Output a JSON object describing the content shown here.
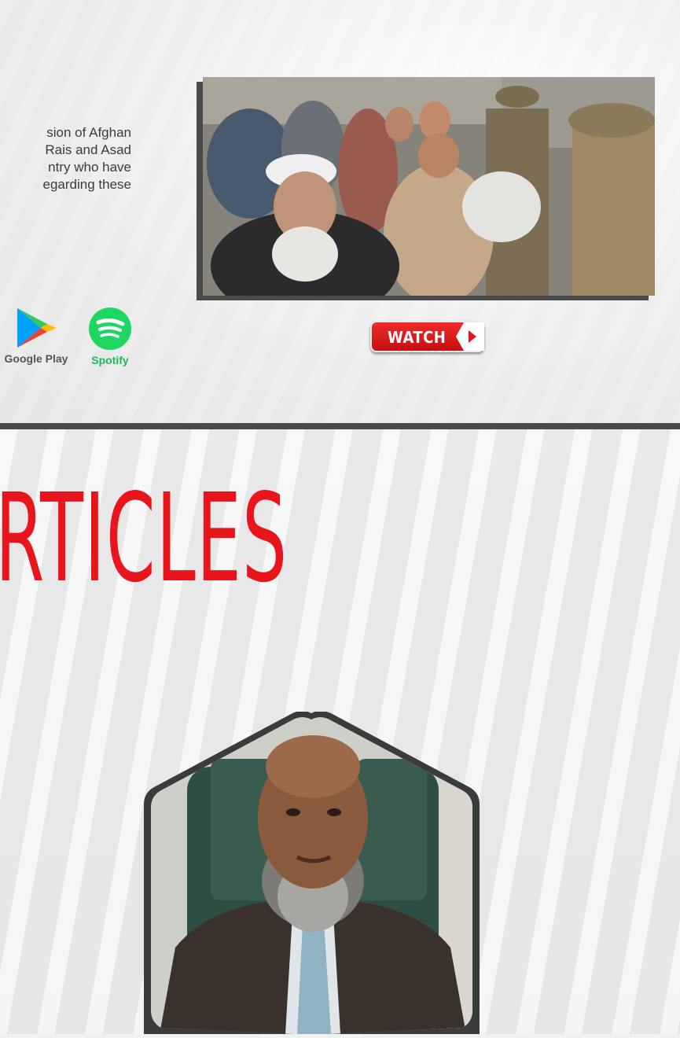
{
  "intro": {
    "description_lines": [
      "sion of Afghan",
      "Rais and Asad",
      "ntry who have",
      "egarding these"
    ]
  },
  "badges": {
    "google_play": {
      "label": "Google Play",
      "icon": "google-play-icon"
    },
    "spotify": {
      "label": "Spotify",
      "icon": "spotify-icon"
    }
  },
  "video": {
    "watch_label": "WATCH",
    "play_icon": "play-icon"
  },
  "section": {
    "title": "RTICLES"
  },
  "colors": {
    "accent_red": "#e8151d",
    "divider": "#4a4a4a",
    "spotify_green": "#1db954"
  }
}
